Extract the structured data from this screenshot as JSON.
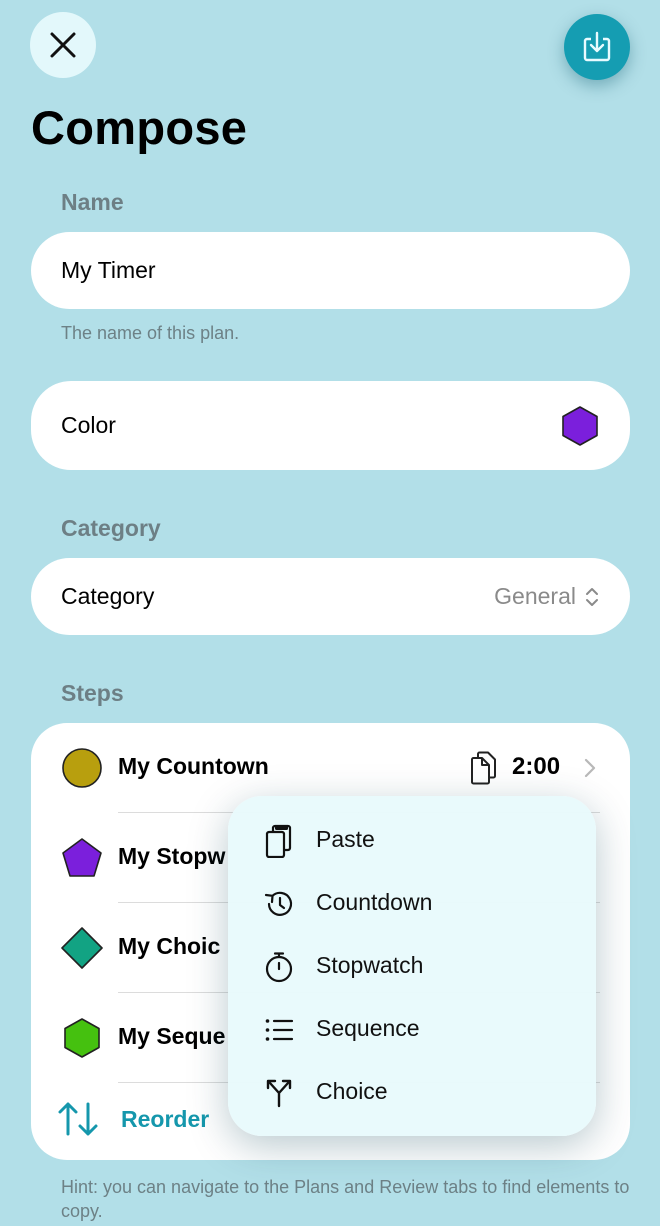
{
  "header": {
    "title": "Compose"
  },
  "name": {
    "section_label": "Name",
    "value": "My Timer",
    "hint": "The name of this plan."
  },
  "color": {
    "label": "Color",
    "swatch_color": "#7b1fdc"
  },
  "category": {
    "section_label": "Category",
    "label": "Category",
    "value": "General"
  },
  "steps": {
    "section_label": "Steps",
    "items": [
      {
        "label": "My Countown",
        "duration": "2:00",
        "shape": "circle",
        "color": "#b89f0e"
      },
      {
        "label": "My Stopw",
        "shape": "pentagon",
        "color": "#7b1fdc"
      },
      {
        "label": "My Choic",
        "shape": "diamond",
        "color": "#12a383"
      },
      {
        "label": "My Seque",
        "shape": "hexagon",
        "color": "#45c10f"
      }
    ],
    "reorder_label": "Reorder"
  },
  "context_menu": {
    "items": [
      {
        "label": "Paste",
        "icon": "paste-icon"
      },
      {
        "label": "Countdown",
        "icon": "countdown-icon"
      },
      {
        "label": "Stopwatch",
        "icon": "stopwatch-icon"
      },
      {
        "label": "Sequence",
        "icon": "sequence-icon"
      },
      {
        "label": "Choice",
        "icon": "choice-icon"
      }
    ]
  },
  "footer": {
    "hint": "Hint: you can navigate to the Plans and Review tabs to find elements to copy."
  }
}
